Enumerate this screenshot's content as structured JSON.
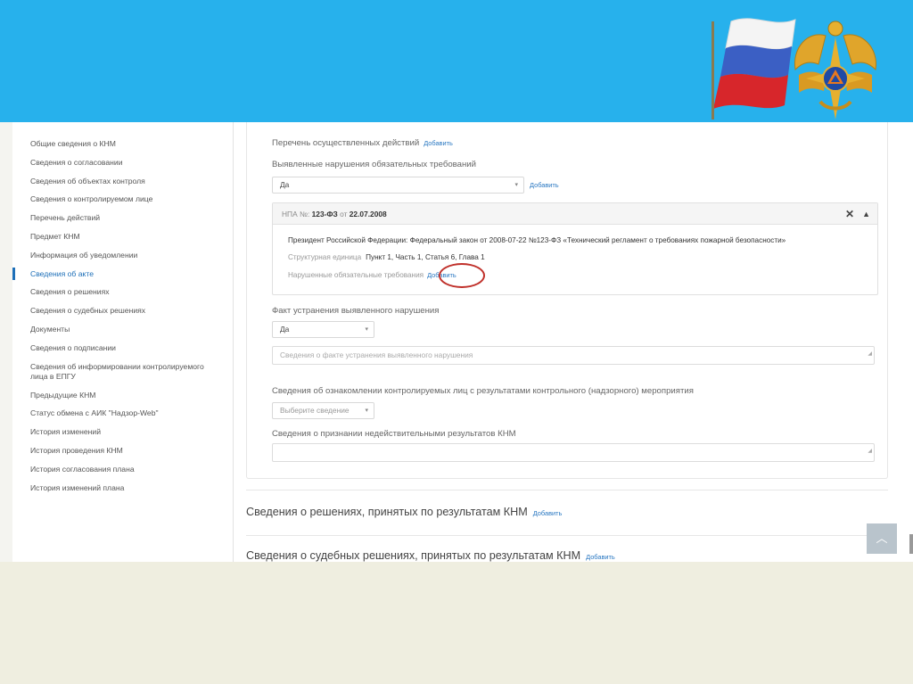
{
  "sidebar": {
    "items": [
      {
        "label": "Общие сведения о КНМ"
      },
      {
        "label": "Сведения о согласовании"
      },
      {
        "label": "Сведения об объектах контроля"
      },
      {
        "label": "Сведения о контролируемом лице"
      },
      {
        "label": "Перечень действий"
      },
      {
        "label": "Предмет КНМ"
      },
      {
        "label": "Информация об уведомлении"
      },
      {
        "label": "Сведения об акте",
        "active": true
      },
      {
        "label": "Сведения о решениях"
      },
      {
        "label": "Сведения о судебных решениях"
      },
      {
        "label": "Документы"
      },
      {
        "label": "Сведения о подписании"
      },
      {
        "label": "Сведения об информировании контролируемого лица в ЕПГУ"
      },
      {
        "label": "Предыдущие КНМ"
      },
      {
        "label": "Статус обмена с АИК \"Надзор-Web\""
      },
      {
        "label": "История изменений"
      },
      {
        "label": "История проведения КНМ"
      },
      {
        "label": "История согласования плана"
      },
      {
        "label": "История изменений плана"
      }
    ]
  },
  "act": {
    "actions_label": "Перечень осуществленных действий",
    "add_label": "Добавить",
    "violations_label": "Выявленные нарушения обязательных требований",
    "violations_value": "Да",
    "npa": {
      "prefix": "НПА №:",
      "number": "123-ФЗ",
      "date_prefix": "от",
      "date": "22.07.2008",
      "title": "Президент Российской Федерации: Федеральный закон от 2008-07-22 №123-ФЗ «Технический регламент о требованиях пожарной безопасности»",
      "unit_label": "Структурная единица",
      "unit_value": "Пункт 1, Часть 1, Статья 6, Глава 1",
      "violated_label": "Нарушенные обязательные требования"
    },
    "fix_label": "Факт устранения выявленного нарушения",
    "fix_value": "Да",
    "fix_placeholder": "Сведения о факте устранения выявленного нарушения",
    "review_label": "Сведения об ознакомлении контролируемых лиц с результатами контрольного (надзорного) мероприятия",
    "review_placeholder": "Выберите сведение",
    "invalid_label": "Сведения о признании недействительными результатов КНМ"
  },
  "sections": {
    "decisions_title": "Сведения о решениях, принятых по результатам КНМ",
    "court_title": "Сведения о судебных решениях, принятых по результатам КНМ"
  },
  "colors": {
    "banner": "#27b1ec",
    "accent": "#2a78c2",
    "highlight": "#c0302a"
  }
}
